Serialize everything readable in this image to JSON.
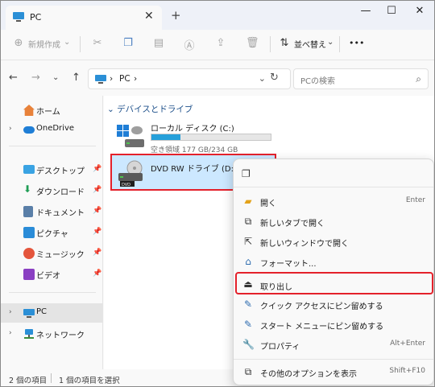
{
  "titlebar": {
    "tab_title": "PC",
    "tab_close": "✕",
    "new_tab": "+",
    "minimize": "—",
    "maximize": "☐",
    "close": "✕"
  },
  "command_bar": {
    "new_label": "新規作成",
    "sort_label": "並べ替え",
    "more_label": "•••"
  },
  "address_bar": {
    "crumb": "PC",
    "search_placeholder": "PCの検索"
  },
  "sidebar": {
    "items": [
      {
        "label": "ホーム"
      },
      {
        "label": "OneDrive"
      },
      {
        "label": "デスクトップ"
      },
      {
        "label": "ダウンロード"
      },
      {
        "label": "ドキュメント"
      },
      {
        "label": "ピクチャ"
      },
      {
        "label": "ミュージック"
      },
      {
        "label": "ビデオ"
      },
      {
        "label": "PC"
      },
      {
        "label": "ネットワーク"
      }
    ]
  },
  "content": {
    "group_title": "デバイスとドライブ",
    "drive_c": {
      "name": "ローカル ディスク (C:)",
      "free_text": "空き領域 177 GB/234 GB",
      "used_fraction": 0.24
    },
    "drive_d": {
      "name": "DVD RW ドライブ (D:)",
      "badge": "DVD"
    }
  },
  "status_bar": {
    "item_count": "2 個の項目",
    "selected": "1 個の項目を選択"
  },
  "context_menu": {
    "items": [
      {
        "label": "開く",
        "shortcut": "Enter"
      },
      {
        "label": "新しいタブで開く",
        "shortcut": ""
      },
      {
        "label": "新しいウィンドウで開く",
        "shortcut": ""
      },
      {
        "label": "フォーマット...",
        "shortcut": ""
      },
      {
        "label": "取り出し",
        "shortcut": ""
      },
      {
        "label": "クイック アクセスにピン留めする",
        "shortcut": ""
      },
      {
        "label": "スタート メニューにピン留めする",
        "shortcut": ""
      },
      {
        "label": "プロパティ",
        "shortcut": "Alt+Enter"
      },
      {
        "label": "その他のオプションを表示",
        "shortcut": "Shift+F10"
      }
    ]
  },
  "colors": {
    "accent": "#26a0da",
    "selection": "#cce8ff",
    "highlight_border": "#e4212b",
    "folder_blue": "#2f6db0"
  }
}
